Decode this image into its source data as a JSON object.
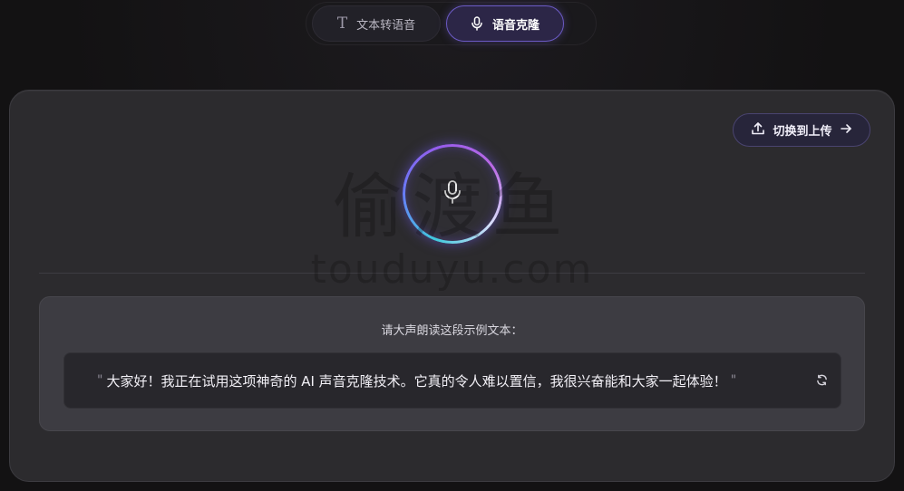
{
  "tabs": {
    "tts_label": "文本转语音",
    "clone_label": "语音克隆",
    "active": "clone"
  },
  "card": {
    "switch_button_label": "切换到上传",
    "sample_prompt": "请大声朗读这段示例文本：",
    "sample_text": "大家好！我正在试用这项神奇的 AI 声音克隆技术。它真的令人难以置信，我很兴奋能和大家一起体验！"
  },
  "watermark": {
    "cn": "偷渡鱼",
    "en": "touduyu.com"
  },
  "colors": {
    "accent": "#6b5ac4",
    "background": "#141314",
    "card": "#2c2b2e"
  }
}
